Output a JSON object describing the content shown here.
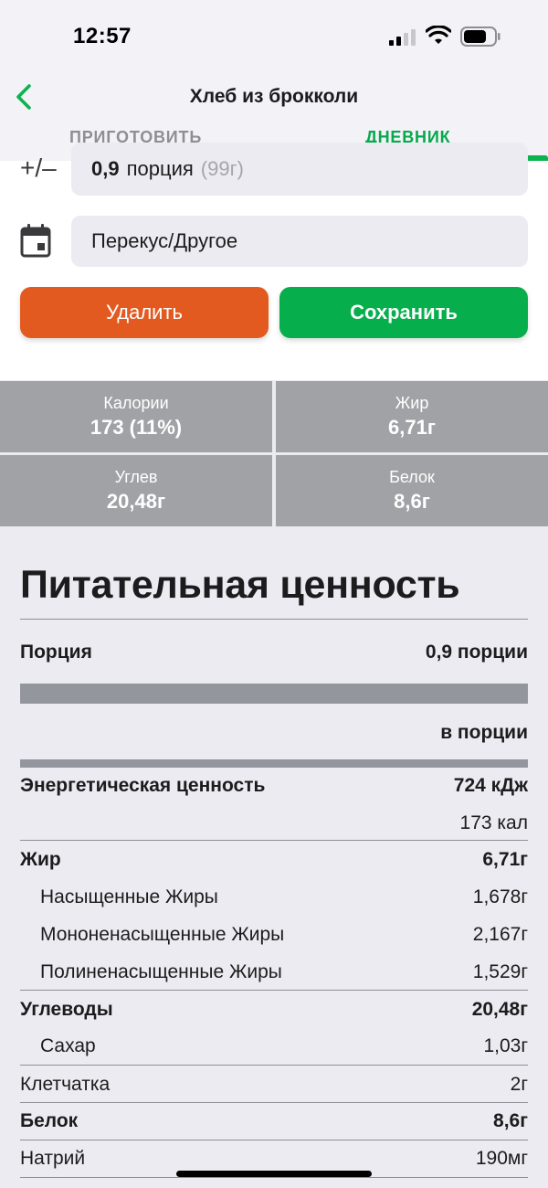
{
  "status_bar": {
    "time": "12:57"
  },
  "header": {
    "title": "Хлеб из брокколи",
    "tabs": [
      {
        "label": "ПРИГОТОВИТЬ",
        "active": false
      },
      {
        "label": "ДНЕВНИК",
        "active": true
      }
    ]
  },
  "form": {
    "plus_minus_icon": "+/–",
    "portion": {
      "number": "0,9",
      "unit": "порция",
      "weight": "(99г)"
    },
    "meal_type": "Перекус/Другое",
    "delete_label": "Удалить",
    "save_label": "Сохранить"
  },
  "macros": [
    {
      "label": "Калории",
      "value": "173 (11%)"
    },
    {
      "label": "Жир",
      "value": "6,71г"
    },
    {
      "label": "Углев",
      "value": "20,48г"
    },
    {
      "label": "Белок",
      "value": "8,6г"
    }
  ],
  "facts": {
    "title": "Питательная ценность",
    "serving_label": "Порция",
    "serving_value": "0,9 порции",
    "per_serving": "в порции",
    "energy_label": "Энергетическая ценность",
    "energy_kj": "724 кДж",
    "energy_kcal": "173 кал",
    "fat_label": "Жир",
    "fat_value": "6,71г",
    "sat_label": "Насыщенные Жиры",
    "sat_value": "1,678г",
    "mono_label": "Мононенасыщенные Жиры",
    "mono_value": "2,167г",
    "poly_label": "Полиненасыщенные Жиры",
    "poly_value": "1,529г",
    "carbs_label": "Углеводы",
    "carbs_value": "20,48г",
    "sugar_label": "Сахар",
    "sugar_value": "1,03г",
    "fiber_label": "Клетчатка",
    "fiber_value": "2г",
    "protein_label": "Белок",
    "protein_value": "8,6г",
    "sodium_label": "Натрий",
    "sodium_value": "190мг"
  },
  "colors": {
    "accent_green": "#07ae4c",
    "delete_orange": "#e35a20",
    "macro_gray": "#a1a2a5"
  },
  "icons": [
    "back-chevron-icon",
    "signal-icon",
    "wifi-icon",
    "battery-icon",
    "calendar-icon"
  ]
}
